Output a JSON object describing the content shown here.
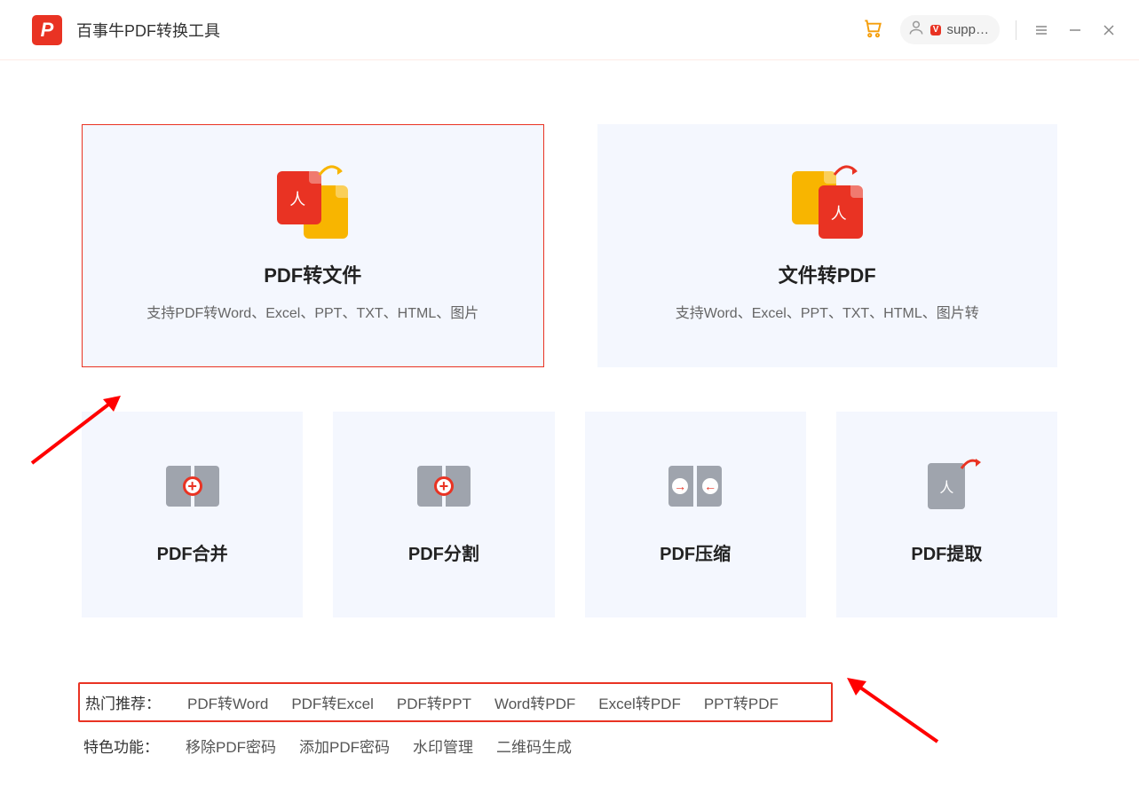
{
  "titlebar": {
    "app_title": "百事牛PDF转换工具",
    "user_name": "supp…"
  },
  "big_cards": [
    {
      "title": "PDF转文件",
      "desc": "支持PDF转Word、Excel、PPT、TXT、HTML、图片"
    },
    {
      "title": "文件转PDF",
      "desc": "支持Word、Excel、PPT、TXT、HTML、图片转"
    }
  ],
  "small_cards": [
    {
      "title": "PDF合并"
    },
    {
      "title": "PDF分割"
    },
    {
      "title": "PDF压缩"
    },
    {
      "title": "PDF提取"
    }
  ],
  "footer": {
    "hot_label": "热门推荐：",
    "hot_links": [
      "PDF转Word",
      "PDF转Excel",
      "PDF转PPT",
      "Word转PDF",
      "Excel转PDF",
      "PPT转PDF"
    ],
    "feature_label": "特色功能：",
    "feature_links": [
      "移除PDF密码",
      "添加PDF密码",
      "水印管理",
      "二维码生成"
    ]
  }
}
